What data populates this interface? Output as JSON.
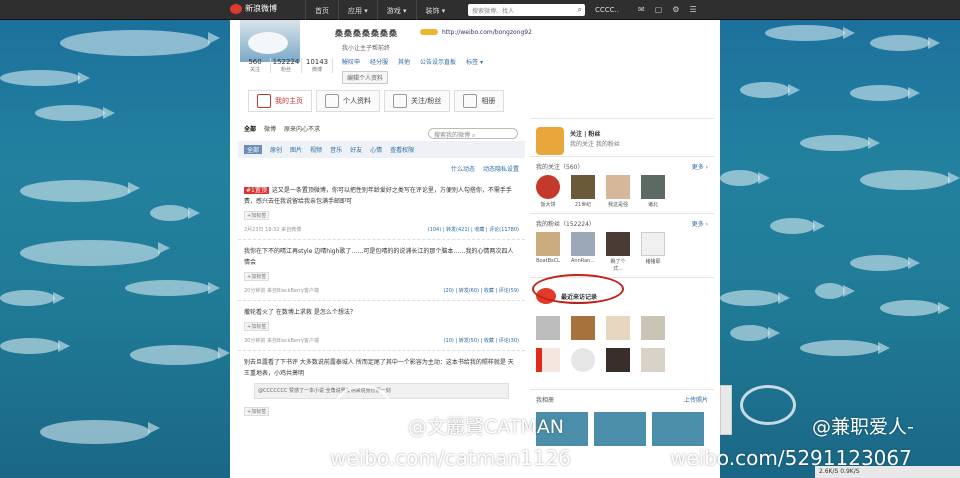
{
  "topbar": {
    "logo_text": "新浪微博",
    "nav": [
      "首页",
      "应用 ▾",
      "游戏 ▾",
      "装饰 ▾"
    ],
    "search_placeholder": "搜索微博、找人",
    "username": "CCCC..",
    "right_icons": [
      "mail-icon",
      "message-icon",
      "gear-icon",
      "menu-icon"
    ]
  },
  "profile": {
    "name": "桑桑桑桑桑桑桑",
    "url": "http://weibo.com/bongzong92",
    "desc": "我小让主子帮前终",
    "meta": [
      "鳗叹申",
      "经分服",
      "其他",
      "公告设示直板",
      "标签 ▾"
    ],
    "stats": [
      {
        "num": "560",
        "label": "关注"
      },
      {
        "num": "152224",
        "label": "粉丝"
      },
      {
        "num": "10143",
        "label": "微博"
      }
    ],
    "edit_label": "编辑个人资料"
  },
  "tabs": [
    "我的主页",
    "个人资料",
    "关注/粉丝",
    "相册"
  ],
  "feed": {
    "filters1": [
      "全部",
      "微博",
      "原来内心不求"
    ],
    "search_placeholder": "搜索我的微博",
    "filters2": [
      "全部",
      "原创",
      "图片",
      "视频",
      "音乐",
      "好友",
      "心情",
      "查看权限"
    ],
    "filters3": [
      "什么动态",
      "动态隐私设置"
    ],
    "posts": [
      {
        "tag": "#1置顶",
        "text": "这又是一条置顶微博，你可以把性别年龄爱好之类写在评论里，方便别人勾搭你，不需手手费，感兴去任我说留给我亲包满手邮即可",
        "label": "+加标签",
        "time": "2月23日 18:32  来自微博",
        "actions": "(104) | 转发(421) | 收藏 | 评论(11780)"
      },
      {
        "tag": "",
        "text": "我你在下不的晴江再style 边晴high歌了……可是包晴的的说浦长江的那个脑本……我的心情两次四人情会",
        "label": "+加标签",
        "time": "20分钟前  来自BlackBerry客户端",
        "actions": "(20) | 转发(60) | 收藏 | 评论(59)"
      },
      {
        "tag": "",
        "text": "撒轮看火了 在数博上求救 是怎么个想法？",
        "label": "+加标签",
        "time": "30分钟前  来自BlackBerry客户端",
        "actions": "(10) | 转发(50) | 收藏 | 评论(30)"
      },
      {
        "tag": "",
        "text": "别去旦露看了下书评 大多数说前露泰城人 所而定尾了其中一个影容为主动：这本书给我的照样就是 天王重地表，小鸡共萧明",
        "quote": "@CCCCCCC 赞感了一本小说 全角说男友明来说身份那一刻",
        "label": "+加标签",
        "time": "",
        "actions": ""
      }
    ]
  },
  "side": {
    "app_title": "关注 | 粉丝",
    "app_sub": "我的关注 我的粉丝",
    "following_head": "我的关注（560）",
    "following": [
      "饭大饼",
      "21世纪",
      "我这是强",
      "诸北"
    ],
    "fans_head": "我的粉丝（152224）",
    "fans": [
      "BoatBsCL",
      "AnnRan...",
      "瞧了个式...",
      "猪猪耶"
    ],
    "more": "更多 ›",
    "visitors_head": "最近来访记录",
    "photos_head": "我相册",
    "photos_more": "上传照片"
  },
  "watermarks": [
    {
      "handle": "@文麗賢CATMAN",
      "url": "weibo.com/catman1126"
    },
    {
      "handle": "@兼职爱人-",
      "url": "weibo.com/5291123067"
    }
  ],
  "statusbar": "2.6K/S    0.9K/S"
}
